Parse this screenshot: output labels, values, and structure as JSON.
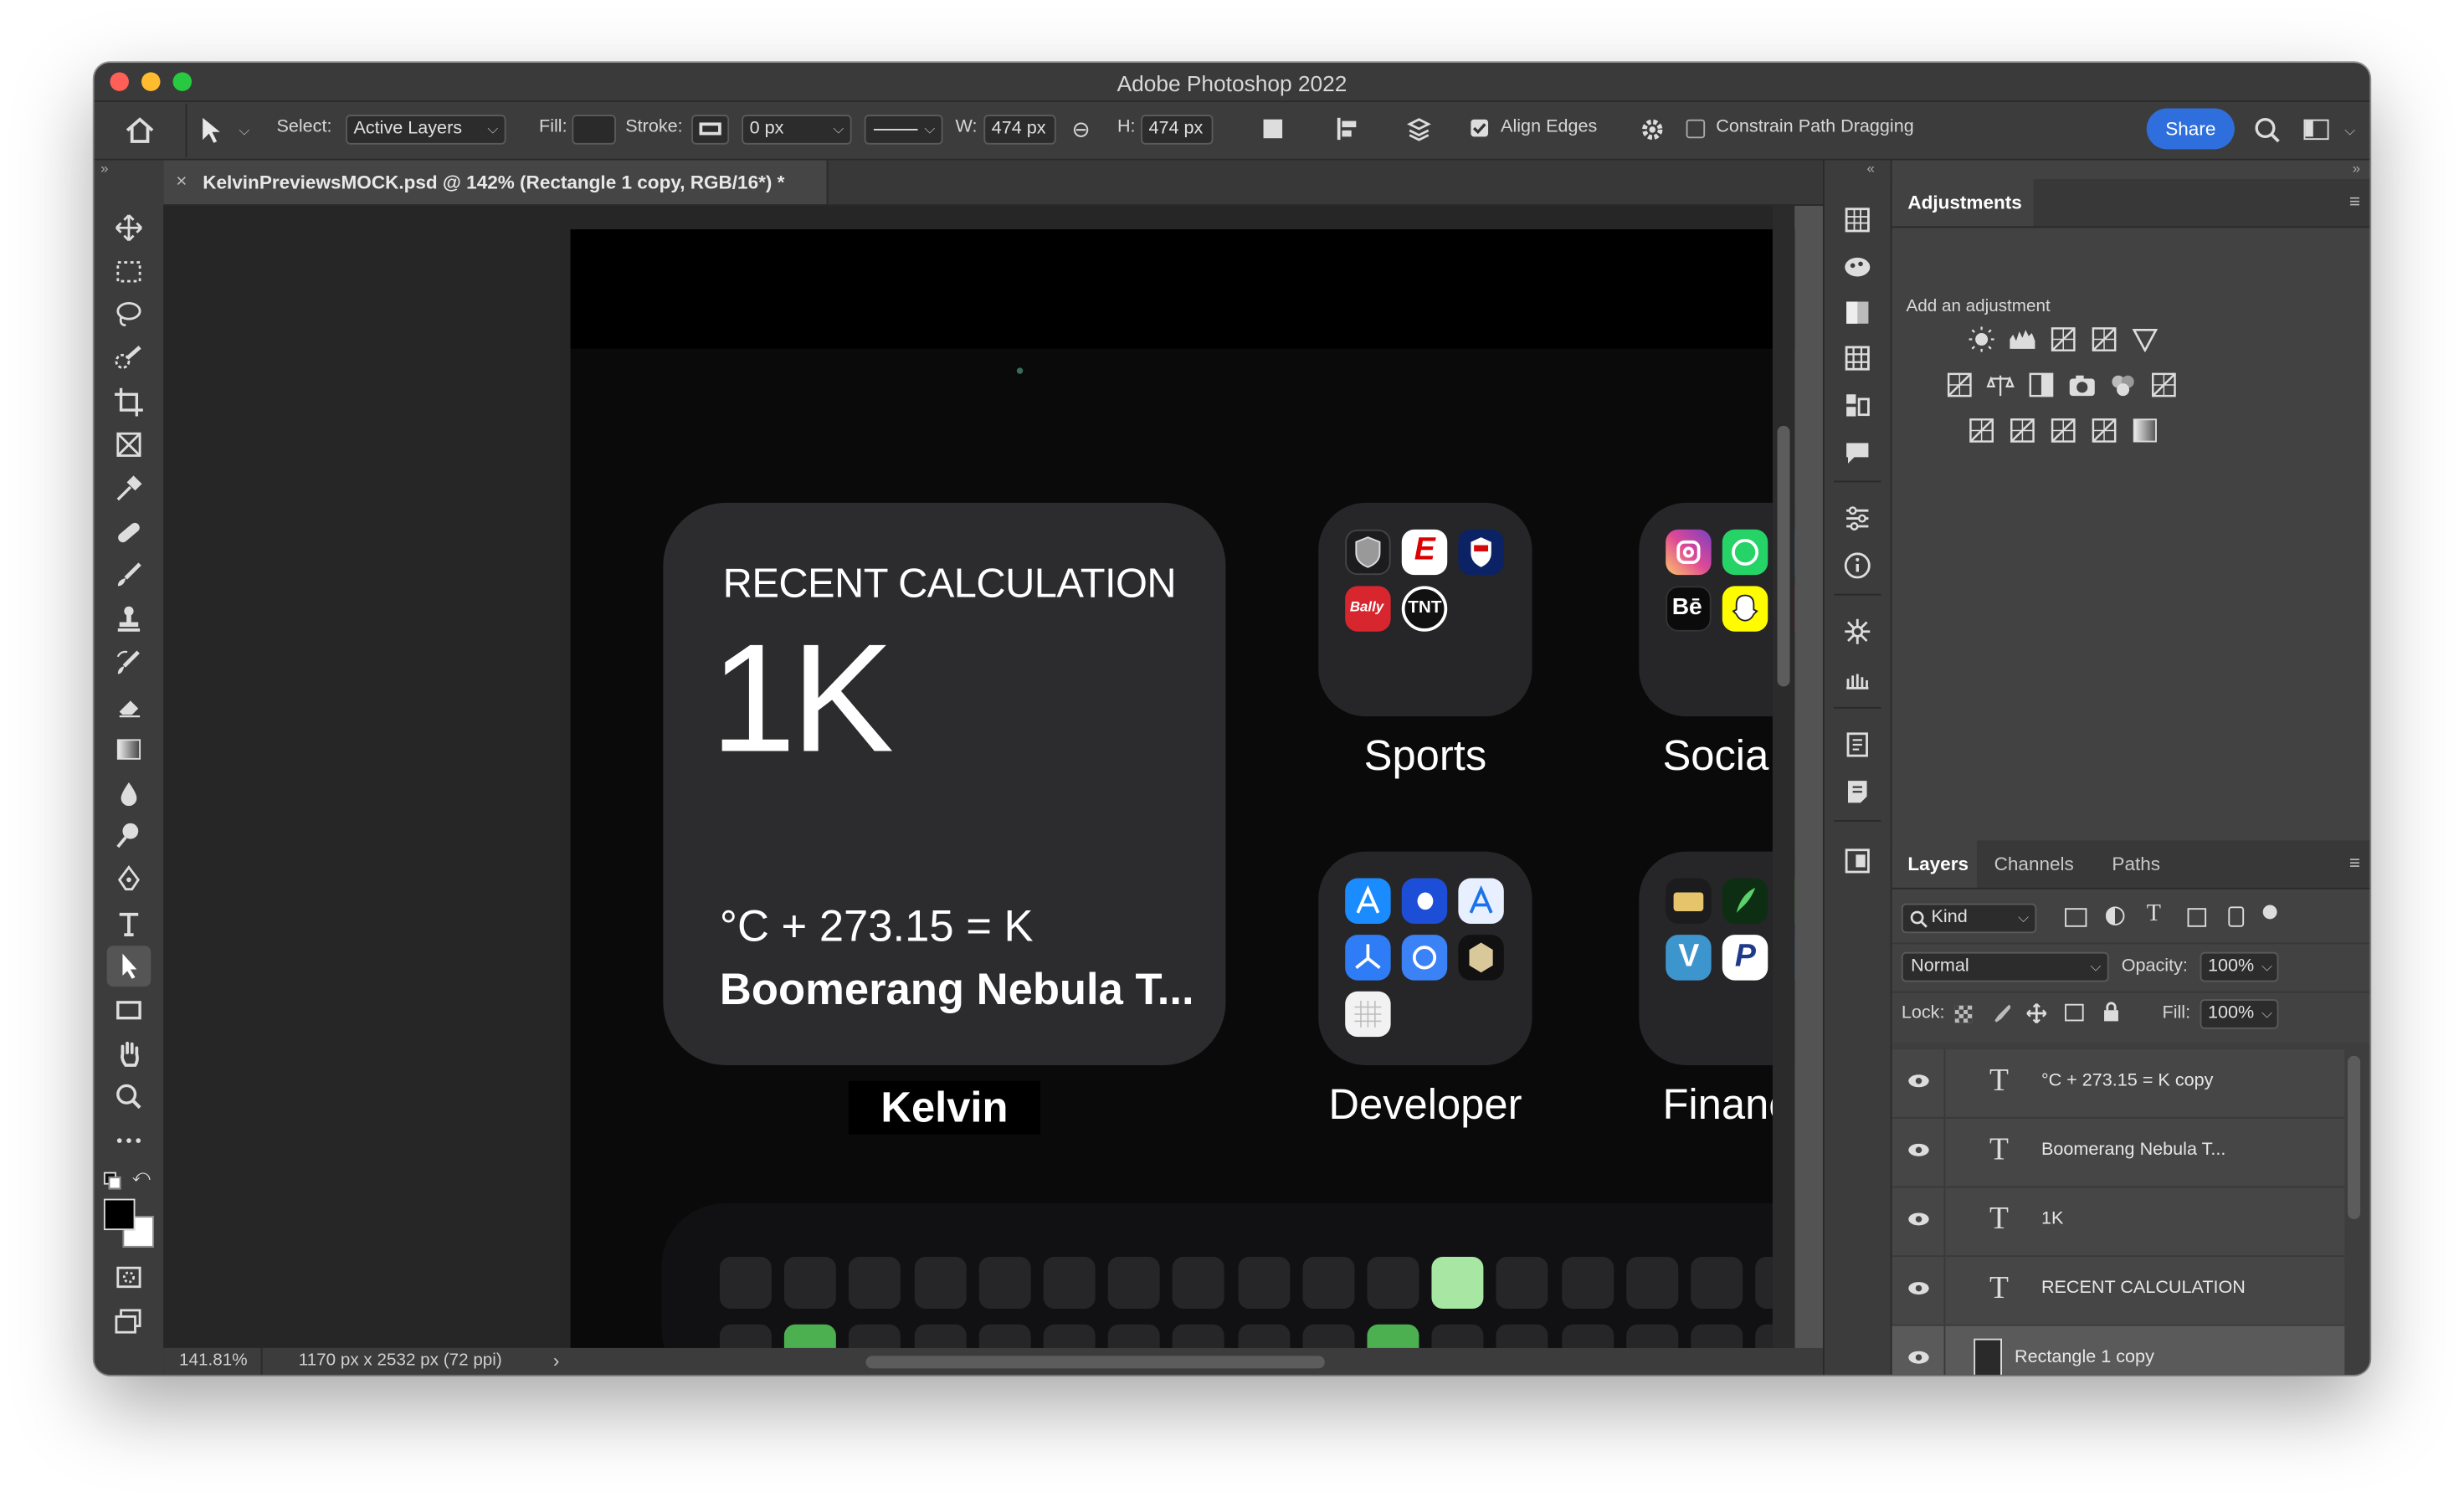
{
  "window": {
    "title": "Adobe Photoshop 2022"
  },
  "options_bar": {
    "select_label": "Select:",
    "select_value": "Active Layers",
    "fill_label": "Fill:",
    "stroke_label": "Stroke:",
    "stroke_width": "0 px",
    "w_label": "W:",
    "w_value": "474 px",
    "h_label": "H:",
    "h_value": "474 px",
    "align_edges": "Align Edges",
    "constrain": "Constrain Path Dragging",
    "share": "Share"
  },
  "document_tab": {
    "title": "KelvinPreviewsMOCK.psd @ 142% (Rectangle 1 copy, RGB/16*) *"
  },
  "canvas": {
    "widget": {
      "heading": "RECENT CALCULATION",
      "value": "1K",
      "formula": "°C + 273.15 = K",
      "subtitle": "Boomerang Nebula T..."
    },
    "labels": {
      "kelvin": "Kelvin",
      "sports": "Sports",
      "social": "Socia",
      "developer": "Developer",
      "finance": "Financ"
    },
    "sports_apps": [
      "NHL",
      "ESPN",
      "NFL",
      "Bally Sports",
      "TNT"
    ],
    "developer_apps": [
      "TestFlight",
      "Apple Developer",
      "App Store Connect",
      "Instruments",
      "GitHub",
      "Hexagon"
    ],
    "social_apps": [
      "Instagram",
      "WhatsApp",
      "Behance",
      "Snapchat"
    ],
    "finance_apps": [
      "Wallet",
      "Robinhood",
      "Venmo",
      "PayPal"
    ]
  },
  "status_bar": {
    "zoom": "141.81%",
    "doc_info": "1170 px x 2532 px (72 ppi)"
  },
  "adjustments": {
    "tab": "Adjustments",
    "hint": "Add an adjustment"
  },
  "layers_panel": {
    "tabs": [
      "Layers",
      "Channels",
      "Paths"
    ],
    "filter_kind": "Kind",
    "blend_mode": "Normal",
    "opacity_label": "Opacity:",
    "opacity_value": "100%",
    "lock_label": "Lock:",
    "fill_label": "Fill:",
    "fill_value": "100%",
    "layers": [
      {
        "name": "°C + 273.15 = K copy",
        "type": "text"
      },
      {
        "name": "Boomerang Nebula T...",
        "type": "text"
      },
      {
        "name": "1K",
        "type": "text"
      },
      {
        "name": "RECENT CALCULATION",
        "type": "text"
      },
      {
        "name": "Rectangle 1 copy",
        "type": "shape",
        "selected": true
      }
    ]
  },
  "colors": {
    "accent_blue": "#2f6fdd",
    "close": "#fe5f57",
    "minimize": "#febc2e",
    "maximize": "#28c840",
    "highlight_green": "#a8e6a3",
    "dark_green": "#4caf50"
  }
}
